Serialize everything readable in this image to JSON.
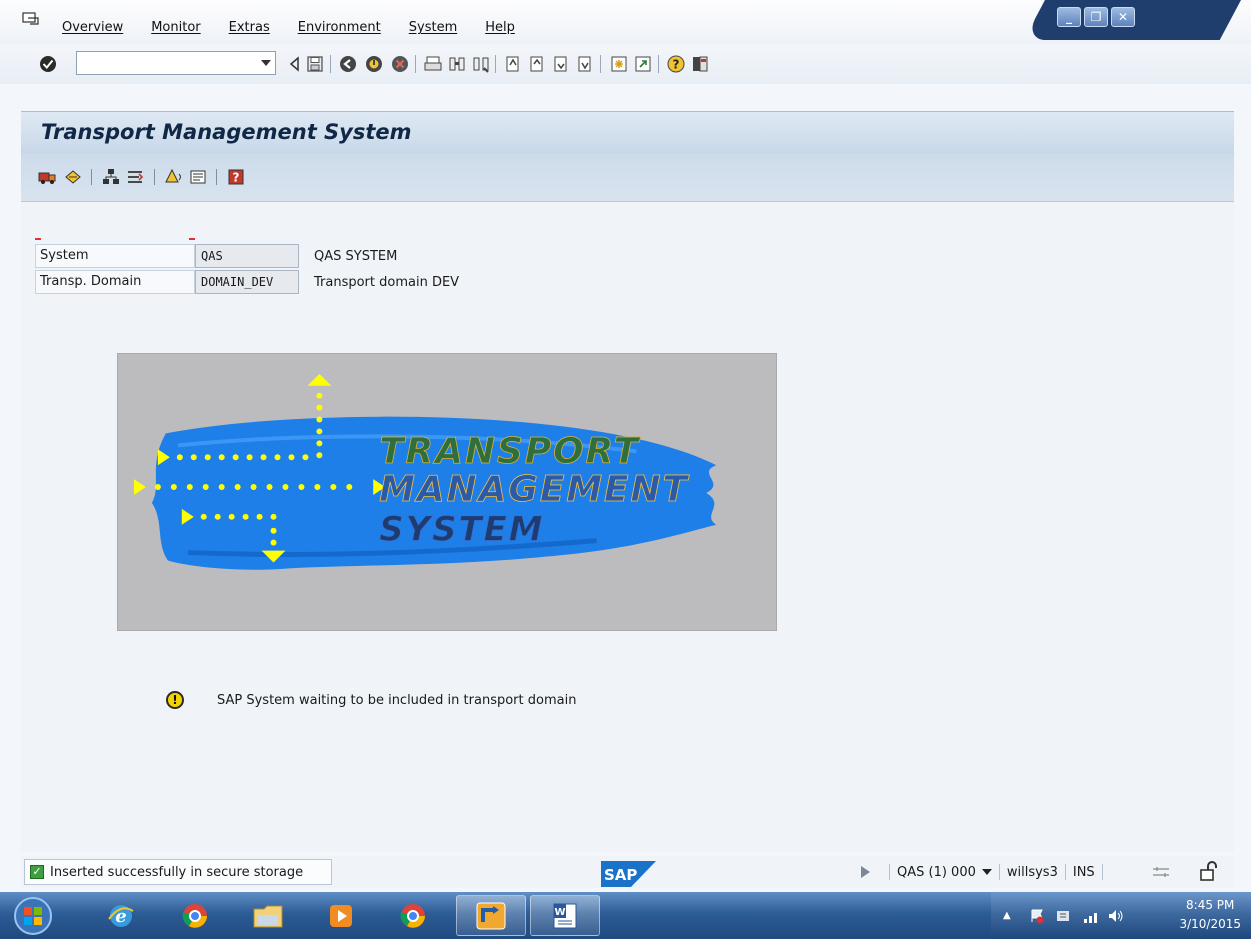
{
  "menubar": {
    "items": [
      "Overview",
      "Monitor",
      "Extras",
      "Environment",
      "System",
      "Help"
    ]
  },
  "command_field": {
    "value": ""
  },
  "window": {
    "title": "Transport Management System"
  },
  "fields": {
    "system": {
      "label": "System",
      "value": "QAS",
      "description": "QAS SYSTEM"
    },
    "domain": {
      "label": "Transp. Domain",
      "value": "DOMAIN_DEV",
      "description": "Transport domain DEV"
    }
  },
  "logo": {
    "line1": "TRANSPORT",
    "line2": "MANAGEMENT",
    "line3": "SYSTEM"
  },
  "message": "SAP System waiting to be included in transport domain",
  "statusbar": {
    "message": "Inserted successfully in secure storage",
    "system": "QAS (1) 000",
    "user": "willsys3",
    "mode": "INS"
  },
  "taskbar": {
    "time": "8:45 PM",
    "date": "3/10/2015"
  },
  "colors": {
    "title_bg": "#c7d7e8",
    "brush_blue": "#1e7fe8",
    "arrow_yellow": "#ffff00",
    "taskbar": "#2d5c96"
  }
}
